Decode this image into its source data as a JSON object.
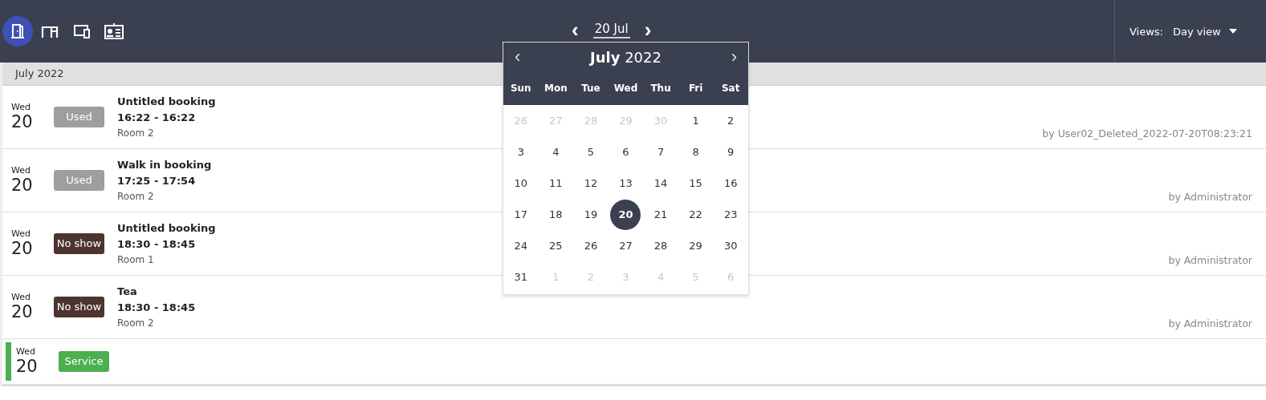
{
  "toolbar": {
    "icons": [
      {
        "kind": "door",
        "selected": true
      },
      {
        "kind": "desk",
        "selected": false
      },
      {
        "kind": "devices",
        "selected": false
      },
      {
        "kind": "badge",
        "selected": false
      }
    ]
  },
  "date_nav": {
    "prev": "‹",
    "label": "20 Jul",
    "next": "›"
  },
  "views": {
    "label": "Views:",
    "value": "Day view"
  },
  "month_header": "July 2022",
  "bookings": [
    {
      "kind": "booking",
      "weekday": "Wed",
      "day": "20",
      "status": "Used",
      "color": "#9e9e9e",
      "title": "Untitled booking",
      "time": "16:22 - 16:22",
      "room": "Room 2",
      "owner": "by User02_Deleted_2022-07-20T08:23:21"
    },
    {
      "kind": "booking",
      "weekday": "Wed",
      "day": "20",
      "status": "Used",
      "color": "#9e9e9e",
      "title": "Walk in booking",
      "time": "17:25 - 17:54",
      "room": "Room 2",
      "owner": "by Administrator"
    },
    {
      "kind": "booking",
      "weekday": "Wed",
      "day": "20",
      "status": "No show",
      "color": "#4e342e",
      "title": "Untitled booking",
      "time": "18:30 - 18:45",
      "room": "Room 1",
      "owner": "by Administrator"
    },
    {
      "kind": "booking",
      "weekday": "Wed",
      "day": "20",
      "status": "No show",
      "color": "#4e342e",
      "title": "Tea",
      "time": "18:30 - 18:45",
      "room": "Room 2",
      "owner": "by Administrator"
    },
    {
      "kind": "service",
      "weekday": "Wed",
      "day": "20",
      "status": "Service",
      "color": "#4caf50"
    }
  ],
  "calendar": {
    "title": "**July** 2022",
    "prev": "‹",
    "next": "›",
    "weekdays": [
      "Sun",
      "Mon",
      "Tue",
      "Wed",
      "Thu",
      "Fri",
      "Sat"
    ],
    "days": [
      {
        "label": "26",
        "muted": true,
        "selected": false
      },
      {
        "label": "27",
        "muted": true,
        "selected": false
      },
      {
        "label": "28",
        "muted": true,
        "selected": false
      },
      {
        "label": "29",
        "muted": true,
        "selected": false
      },
      {
        "label": "30",
        "muted": true,
        "selected": false
      },
      {
        "label": "1",
        "muted": false,
        "selected": false
      },
      {
        "label": "2",
        "muted": false,
        "selected": false
      },
      {
        "label": "3",
        "muted": false,
        "selected": false
      },
      {
        "label": "4",
        "muted": false,
        "selected": false
      },
      {
        "label": "5",
        "muted": false,
        "selected": false
      },
      {
        "label": "6",
        "muted": false,
        "selected": false
      },
      {
        "label": "7",
        "muted": false,
        "selected": false
      },
      {
        "label": "8",
        "muted": false,
        "selected": false
      },
      {
        "label": "9",
        "muted": false,
        "selected": false
      },
      {
        "label": "10",
        "muted": false,
        "selected": false
      },
      {
        "label": "11",
        "muted": false,
        "selected": false
      },
      {
        "label": "12",
        "muted": false,
        "selected": false
      },
      {
        "label": "13",
        "muted": false,
        "selected": false
      },
      {
        "label": "14",
        "muted": false,
        "selected": false
      },
      {
        "label": "15",
        "muted": false,
        "selected": false
      },
      {
        "label": "16",
        "muted": false,
        "selected": false
      },
      {
        "label": "17",
        "muted": false,
        "selected": false
      },
      {
        "label": "18",
        "muted": false,
        "selected": false
      },
      {
        "label": "19",
        "muted": false,
        "selected": false
      },
      {
        "label": "20",
        "muted": false,
        "selected": true
      },
      {
        "label": "21",
        "muted": false,
        "selected": false
      },
      {
        "label": "22",
        "muted": false,
        "selected": false
      },
      {
        "label": "23",
        "muted": false,
        "selected": false
      },
      {
        "label": "24",
        "muted": false,
        "selected": false
      },
      {
        "label": "25",
        "muted": false,
        "selected": false
      },
      {
        "label": "26",
        "muted": false,
        "selected": false
      },
      {
        "label": "27",
        "muted": false,
        "selected": false
      },
      {
        "label": "28",
        "muted": false,
        "selected": false
      },
      {
        "label": "29",
        "muted": false,
        "selected": false
      },
      {
        "label": "30",
        "muted": false,
        "selected": false
      },
      {
        "label": "31",
        "muted": false,
        "selected": false
      },
      {
        "label": "1",
        "muted": true,
        "selected": false
      },
      {
        "label": "2",
        "muted": true,
        "selected": false
      },
      {
        "label": "3",
        "muted": true,
        "selected": false
      },
      {
        "label": "4",
        "muted": true,
        "selected": false
      },
      {
        "label": "5",
        "muted": true,
        "selected": false
      },
      {
        "label": "6",
        "muted": true,
        "selected": false
      }
    ]
  }
}
